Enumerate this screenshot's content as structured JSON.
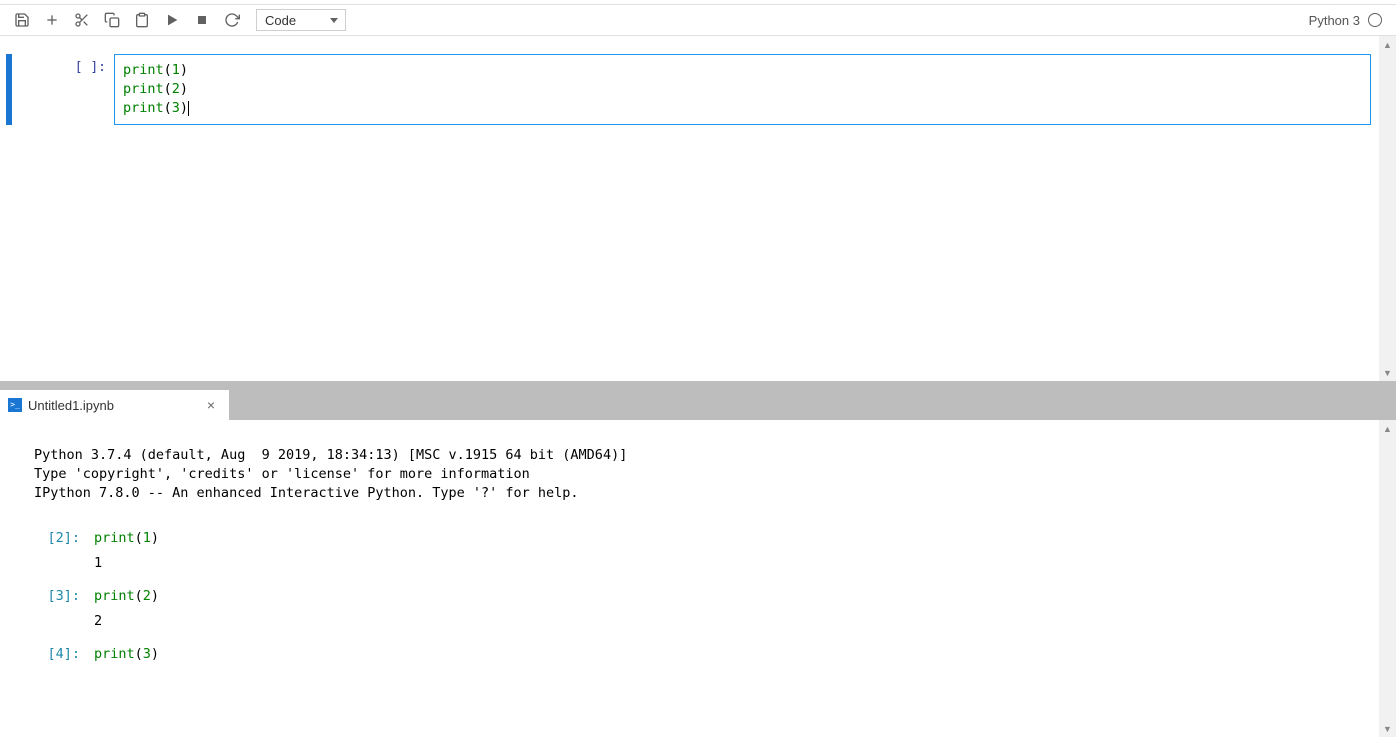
{
  "toolbar": {
    "cell_type": "Code"
  },
  "kernel": {
    "name": "Python 3"
  },
  "notebook": {
    "cell": {
      "prompt": "[ ]:",
      "lines": [
        {
          "func": "print",
          "open": "(",
          "num": "1",
          "close": ")"
        },
        {
          "func": "print",
          "open": "(",
          "num": "2",
          "close": ")"
        },
        {
          "func": "print",
          "open": "(",
          "num": "3",
          "close": ")"
        }
      ]
    }
  },
  "console": {
    "tab_label": "Untitled1.ipynb",
    "tab_close": "×",
    "banner": "Python 3.7.4 (default, Aug  9 2019, 18:34:13) [MSC v.1915 64 bit (AMD64)]\nType 'copyright', 'credits' or 'license' for more information\nIPython 7.8.0 -- An enhanced Interactive Python. Type '?' for help.",
    "entries": [
      {
        "prompt": "[2]:",
        "func": "print",
        "open": "(",
        "num": "1",
        "close": ")",
        "output": "1"
      },
      {
        "prompt": "[3]:",
        "func": "print",
        "open": "(",
        "num": "2",
        "close": ")",
        "output": "2"
      },
      {
        "prompt": "[4]:",
        "func": "print",
        "open": "(",
        "num": "3",
        "close": ")",
        "output": ""
      }
    ]
  },
  "scroll": {
    "up": "▲",
    "down": "▼"
  }
}
